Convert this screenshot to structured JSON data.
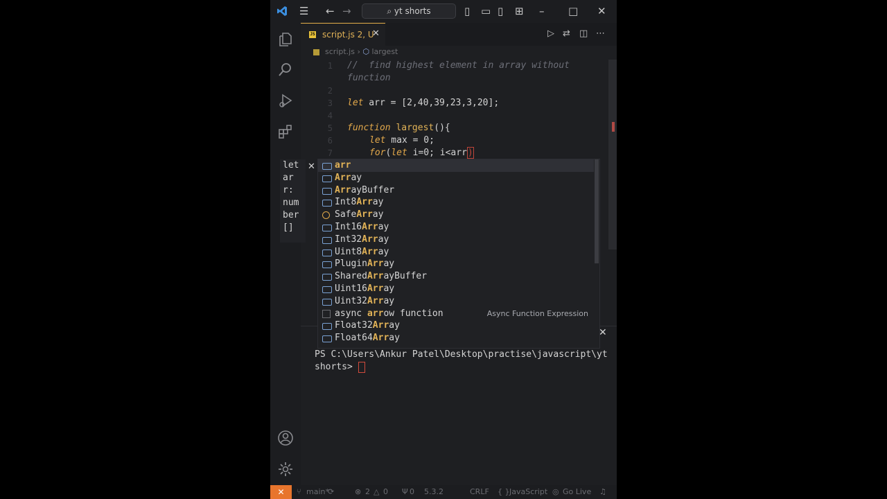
{
  "titlebar": {
    "search_text": "yt shorts"
  },
  "tab": {
    "filename": "script.js",
    "badge": "2, U",
    "js_icon_text": "JS"
  },
  "breadcrumb": {
    "file": "script.js",
    "symbol": "largest"
  },
  "editor": {
    "line_numbers": [
      "1",
      "2",
      "3",
      "4",
      "5",
      "6",
      "7"
    ],
    "lines": [
      "//  find highest element in array without",
      "function",
      "let arr = [2,40,39,23,3,20];",
      "function largest(){",
      "let max = 0;",
      "for(let i=0; i<arr"
    ]
  },
  "hover": {
    "lines": [
      "let",
      "ar",
      "r:",
      "num",
      "ber",
      "[]"
    ]
  },
  "suggestions": [
    {
      "label": "arr",
      "icon": "variable-icon"
    },
    {
      "label": "Array",
      "icon": "variable-icon"
    },
    {
      "label": "ArrayBuffer",
      "icon": "variable-icon"
    },
    {
      "label": "Int8Array",
      "icon": "variable-icon"
    },
    {
      "label": "SafeArray",
      "icon": "class-icon"
    },
    {
      "label": "Int16Array",
      "icon": "variable-icon"
    },
    {
      "label": "Int32Array",
      "icon": "variable-icon"
    },
    {
      "label": "Uint8Array",
      "icon": "variable-icon"
    },
    {
      "label": "PluginArray",
      "icon": "variable-icon"
    },
    {
      "label": "SharedArrayBuffer",
      "icon": "variable-icon"
    },
    {
      "label": "Uint16Array",
      "icon": "variable-icon"
    },
    {
      "label": "Uint32Array",
      "icon": "variable-icon"
    },
    {
      "label": "async arrow function",
      "icon": "snippet-icon",
      "detail": "Async Function Expression"
    },
    {
      "label": "Float32Array",
      "icon": "variable-icon"
    },
    {
      "label": "Float64Array",
      "icon": "variable-icon"
    }
  ],
  "terminal": {
    "prompt": "PS C:\\Users\\Ankur Patel\\Desktop\\practise\\javascript\\yt shorts> "
  },
  "statusbar": {
    "branch": "main*",
    "problems": "2",
    "warnings": "0",
    "ports": "0",
    "version": "5.3.2",
    "eol": "CRLF",
    "language": "JavaScript",
    "golive": "Go Live"
  },
  "colors": {
    "accent": "#e2b357",
    "background": "#1e1f22",
    "remote": "#e8752d"
  }
}
